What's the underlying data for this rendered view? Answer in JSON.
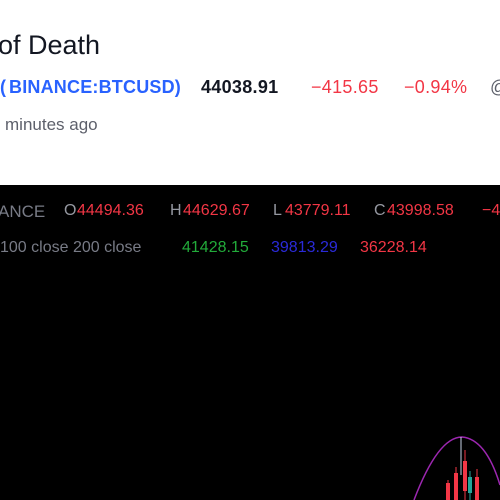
{
  "header": {
    "title": "of Death",
    "symbol_open": "(",
    "symbol": "BINANCE:BTCUSD",
    "symbol_close": ")",
    "price": "44038.91",
    "change": "−415.65",
    "change_pct": "−0.94%",
    "more_icon": "partial-icon",
    "time_ago": "minutes ago"
  },
  "chart": {
    "exchange": "ANCE",
    "ohlc": {
      "o_label": "O",
      "o_value": "44494.36",
      "h_label": "H",
      "h_value": "44629.67",
      "l_label": "L",
      "l_value": "43779.11",
      "c_label": "C",
      "c_value": "43998.58",
      "change_partial": "−4"
    },
    "ma": {
      "label": "100 close 200 close",
      "v1": "41428.15",
      "v2": "39813.29",
      "v3": "36228.14"
    },
    "colors": {
      "background": "#000000",
      "down": "#f23645",
      "ma_green": "#22ab3a",
      "ma_blue": "#2a2ad8",
      "ma_red": "#f23645",
      "arc": "#9c27b0"
    }
  }
}
